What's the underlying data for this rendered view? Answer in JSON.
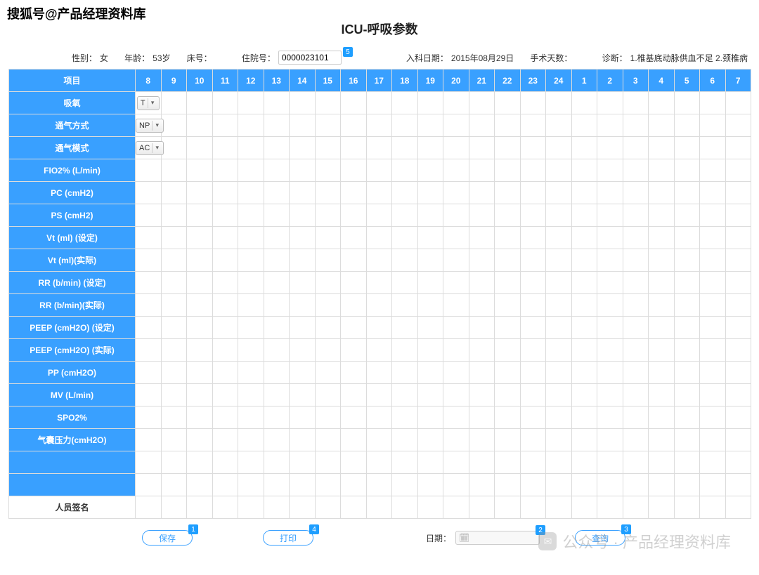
{
  "watermark_top": "搜狐号@产品经理资料库",
  "watermark_bottom": "公众号 · 产品经理资料库",
  "title": "ICU-呼吸参数",
  "info": {
    "gender_label": "性别：",
    "gender_value": "女",
    "age_label": "年龄：",
    "age_value": "53岁",
    "bed_label": "床号：",
    "bed_value": "",
    "adm_label": "住院号：",
    "adm_value": "0000023101",
    "adm_badge": "5",
    "indate_label": "入科日期：",
    "indate_value": "2015年08月29日",
    "opdays_label": "手术天数：",
    "opdays_value": "",
    "diag_label": "诊断：",
    "diag_value": "1.椎基底动脉供血不足 2.颈椎病"
  },
  "table": {
    "header_label": "项目",
    "hours": [
      "8",
      "9",
      "10",
      "11",
      "12",
      "13",
      "14",
      "15",
      "16",
      "17",
      "18",
      "19",
      "20",
      "21",
      "22",
      "23",
      "24",
      "1",
      "2",
      "3",
      "4",
      "5",
      "6",
      "7"
    ],
    "rows": [
      {
        "label": "吸氧",
        "type": "select",
        "value": "T"
      },
      {
        "label": "通气方式",
        "type": "select",
        "value": "NP"
      },
      {
        "label": "通气模式",
        "type": "select",
        "value": "AC"
      },
      {
        "label": "FIO2% (L/min)",
        "type": "text"
      },
      {
        "label": "PC (cmH2)",
        "type": "text"
      },
      {
        "label": "PS (cmH2)",
        "type": "text"
      },
      {
        "label": "Vt (ml) (设定)",
        "type": "text"
      },
      {
        "label": "Vt (ml)(实际)",
        "type": "text"
      },
      {
        "label": "RR (b/min) (设定)",
        "type": "text"
      },
      {
        "label": "RR (b/min)(实际)",
        "type": "text"
      },
      {
        "label": "PEEP (cmH2O) (设定)",
        "type": "text"
      },
      {
        "label": "PEEP (cmH2O) (实际)",
        "type": "text"
      },
      {
        "label": "PP (cmH2O)",
        "type": "text"
      },
      {
        "label": "MV (L/min)",
        "type": "text"
      },
      {
        "label": "SPO2%",
        "type": "text"
      },
      {
        "label": "气囊压力(cmH2O)",
        "type": "text"
      },
      {
        "label": "",
        "type": "blank"
      },
      {
        "label": "",
        "type": "blank"
      }
    ],
    "signature_label": "人员签名"
  },
  "footer": {
    "save_label": "保存",
    "save_badge": "1",
    "print_label": "打印",
    "print_badge": "4",
    "date_label": "日期：",
    "date_value": "",
    "date_badge": "2",
    "query_label": "查询",
    "query_badge": "3"
  }
}
